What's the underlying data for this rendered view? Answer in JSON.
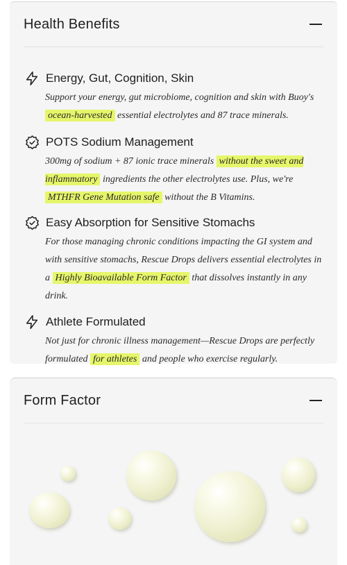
{
  "benefits_panel": {
    "title": "Health Benefits",
    "items": [
      {
        "icon": "lightning-bolt-icon",
        "title": "Energy, Gut, Cognition, Skin",
        "desc_before": "Support your energy, gut microbiome, cognition and skin with Buoy's ",
        "highlight": "ocean-harvested",
        "desc_after": " essential electrolytes and 87 trace minerals."
      },
      {
        "icon": "badge-check-icon",
        "title": "POTS Sodium Management",
        "desc_before": "300mg of sodium + 87 ionic trace minerals ",
        "highlight": "without the sweet and inflammatory",
        "desc_middle": " ingredients the other electrolytes use. Plus, we're ",
        "highlight2": "MTHFR Gene Mutation safe",
        "desc_after": " without the B Vitamins."
      },
      {
        "icon": "badge-check-icon",
        "title": "Easy Absorption for Sensitive Stomachs",
        "desc_before": "For those managing chronic conditions impacting the GI system and with sensitive stomachs, Rescue Drops delivers essential electrolytes in a ",
        "highlight": "Highly Bioavailable Form Factor",
        "desc_after": " that dissolves instantly in any drink."
      },
      {
        "icon": "lightning-bolt-icon",
        "title": "Athlete Formulated",
        "desc_before": "Not just for chronic illness management—Rescue Drops are perfectly formulated ",
        "highlight": "for athletes",
        "desc_after": " and people who exercise regularly."
      }
    ]
  },
  "form_panel": {
    "title": "Form Factor"
  },
  "colors": {
    "panel_bg": "#f5f5f5",
    "highlight": "#e6f66a",
    "drop": "#eef0cf"
  }
}
